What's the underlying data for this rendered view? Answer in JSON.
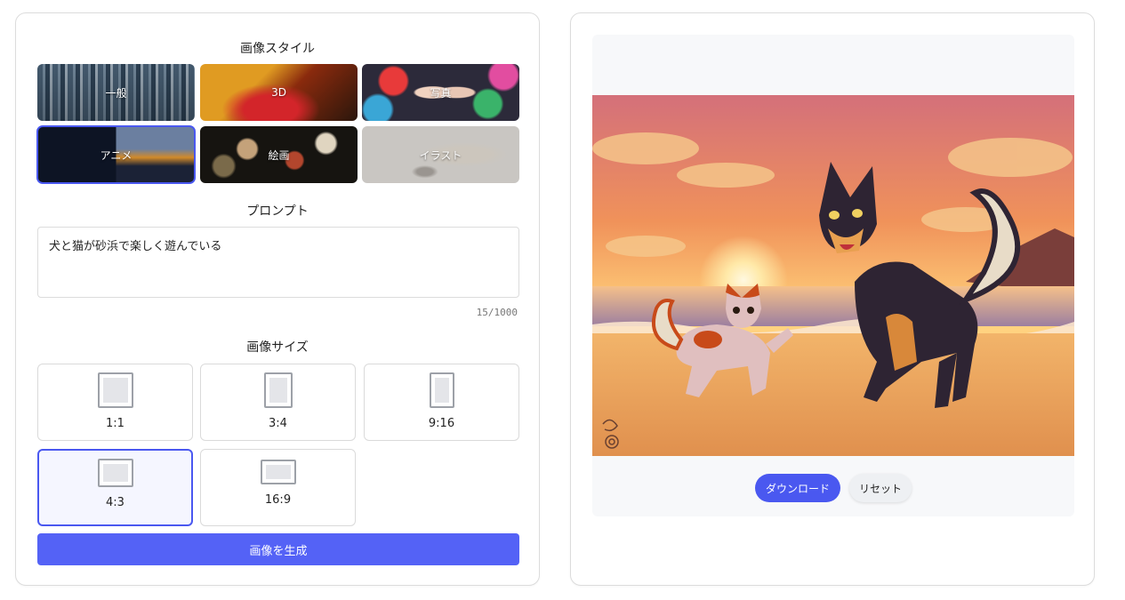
{
  "style_section": {
    "title": "画像スタイル",
    "styles": [
      {
        "label": "一般"
      },
      {
        "label": "3D"
      },
      {
        "label": "写真"
      },
      {
        "label": "アニメ",
        "selected": true
      },
      {
        "label": "絵画"
      },
      {
        "label": "イラスト"
      }
    ]
  },
  "prompt_section": {
    "title": "プロンプト",
    "value": "犬と猫が砂浜で楽しく遊んでいる",
    "char_count": "15/1000"
  },
  "size_section": {
    "title": "画像サイズ",
    "sizes": [
      {
        "label": "1:1"
      },
      {
        "label": "3:4"
      },
      {
        "label": "9:16"
      },
      {
        "label": "4:3",
        "selected": true
      },
      {
        "label": "16:9"
      }
    ]
  },
  "generate_label": "画像を生成",
  "preview": {
    "download_label": "ダウンロード",
    "reset_label": "リセット"
  },
  "colors": {
    "accent": "#4a58f0",
    "generate_button": "#5462f6"
  }
}
